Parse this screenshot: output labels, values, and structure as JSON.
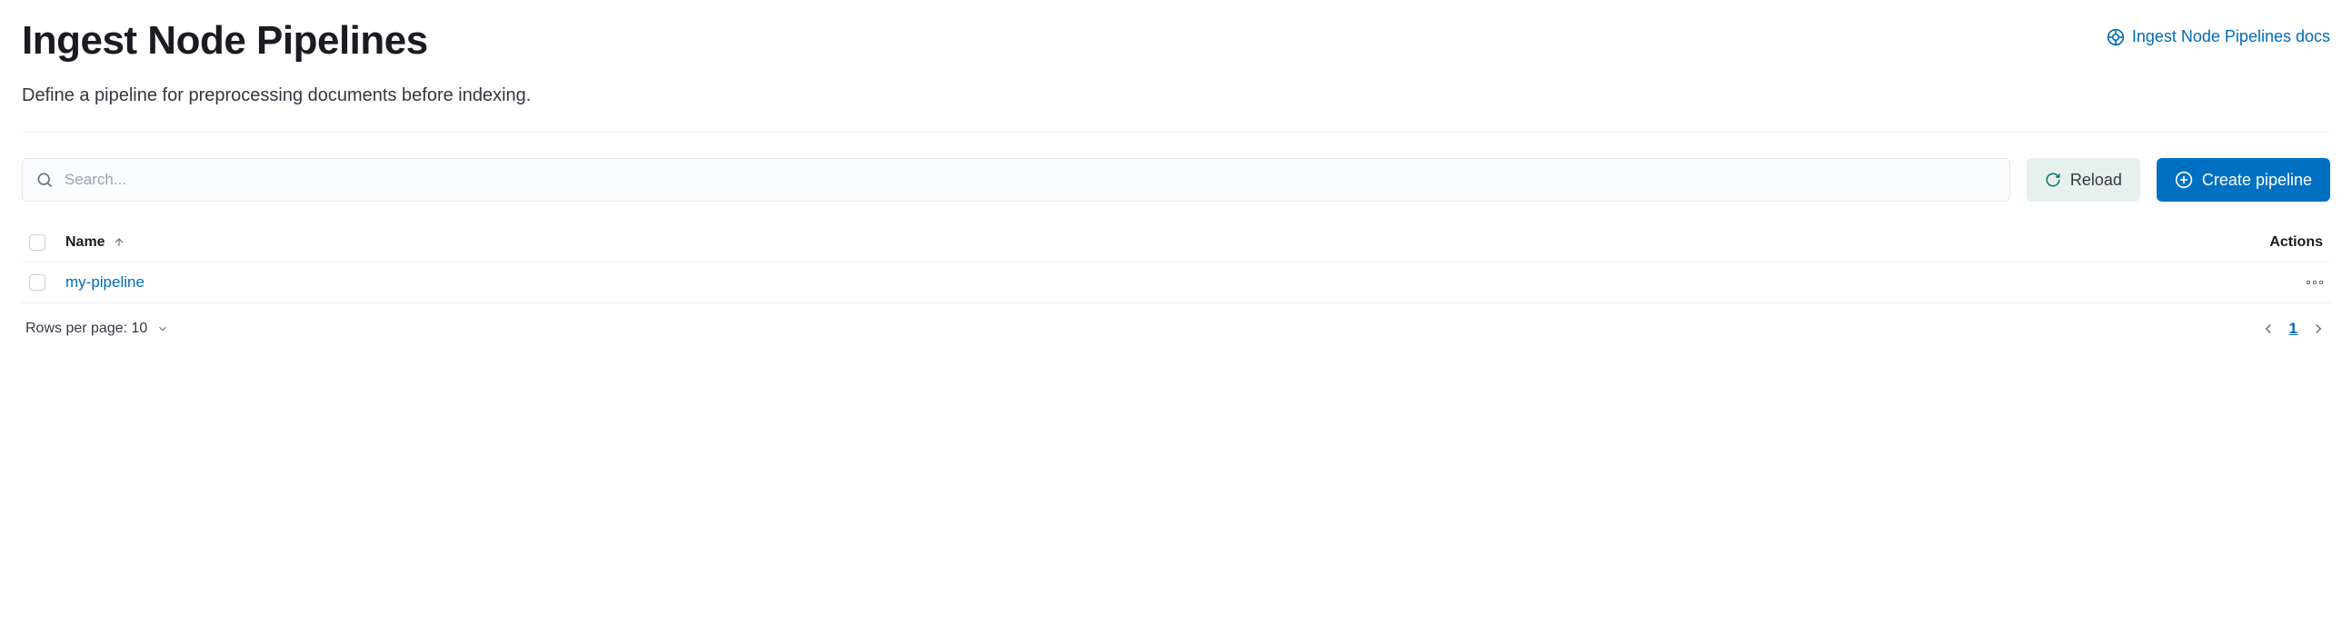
{
  "header": {
    "title": "Ingest Node Pipelines",
    "docs_link_label": "Ingest Node Pipelines docs",
    "subtitle": "Define a pipeline for preprocessing documents before indexing."
  },
  "search": {
    "placeholder": "Search..."
  },
  "buttons": {
    "reload_label": "Reload",
    "create_label": "Create pipeline"
  },
  "table": {
    "columns": {
      "name": "Name",
      "actions": "Actions"
    },
    "rows": [
      {
        "name": "my-pipeline"
      }
    ]
  },
  "footer": {
    "rows_per_page_label": "Rows per page: 10",
    "current_page": "1"
  }
}
